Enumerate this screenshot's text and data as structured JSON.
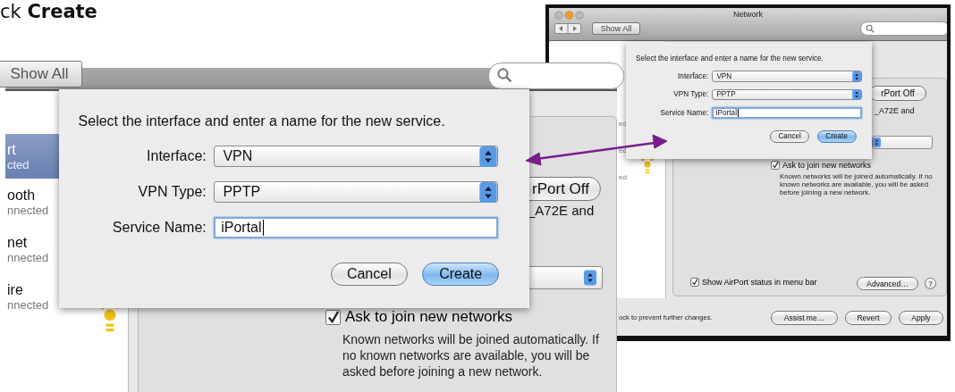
{
  "instruction": "ck **Create**",
  "zoomed_view": {
    "show_all": "Show All",
    "sidebar": [
      {
        "name": "rt",
        "status": "cted",
        "selected": true
      },
      {
        "name": "ooth",
        "status": "nnected",
        "selected": false
      },
      {
        "name": "net",
        "status": "nnected",
        "selected": false
      },
      {
        "name": "ire",
        "status": "nnected",
        "selected": false
      }
    ],
    "airport_button": "rPort Off",
    "network_text": "_A72E and",
    "ask_checkbox": {
      "label": "Ask to join new networks",
      "checked": true
    },
    "ask_help": "Known networks will be joined automatically. If no known networks are available, you will be asked before joining a new network.",
    "dialog": {
      "prompt": "Select the interface and enter a name for the new service.",
      "fields": [
        {
          "label": "Interface:",
          "value": "VPN",
          "kind": "popup"
        },
        {
          "label": "VPN Type:",
          "value": "PPTP",
          "kind": "popup"
        },
        {
          "label": "Service Name:",
          "value": "iPortal",
          "kind": "text",
          "focused": true
        }
      ],
      "buttons": [
        {
          "label": "Cancel",
          "default": false
        },
        {
          "label": "Create",
          "default": true
        }
      ]
    }
  },
  "window": {
    "title": "Network",
    "show_all": "Show All",
    "sidebar": [
      {
        "status": "ed"
      },
      {
        "status": "ed"
      },
      {
        "status": "ed"
      }
    ],
    "dialog": {
      "prompt": "Select the interface and enter a name for the new service.",
      "fields": [
        {
          "label": "Interface:",
          "value": "VPN",
          "kind": "popup"
        },
        {
          "label": "VPN Type:",
          "value": "PPTP",
          "kind": "popup"
        },
        {
          "label": "Service Name:",
          "value": "iPortal",
          "kind": "text",
          "focused": true
        }
      ],
      "buttons": [
        {
          "label": "Cancel",
          "default": false
        },
        {
          "label": "Create",
          "default": true
        }
      ]
    },
    "airport_button": "rPort Off",
    "network_text": "_A72E and",
    "ask_checkbox": {
      "label": "Ask to join new networks",
      "checked": true
    },
    "ask_help": "Known networks will be joined automatically. If no known networks are available, you will be asked before joining a new network.",
    "status_checkbox": {
      "label": "Show AirPort status in menu bar",
      "checked": true
    },
    "advanced_button": "Advanced…",
    "help_button": "?",
    "lock_text": "ock to prevent further changes.",
    "buttons": [
      {
        "label": "Assist me…",
        "default": false
      },
      {
        "label": "Revert",
        "default": false
      },
      {
        "label": "Apply",
        "default": false
      }
    ]
  }
}
